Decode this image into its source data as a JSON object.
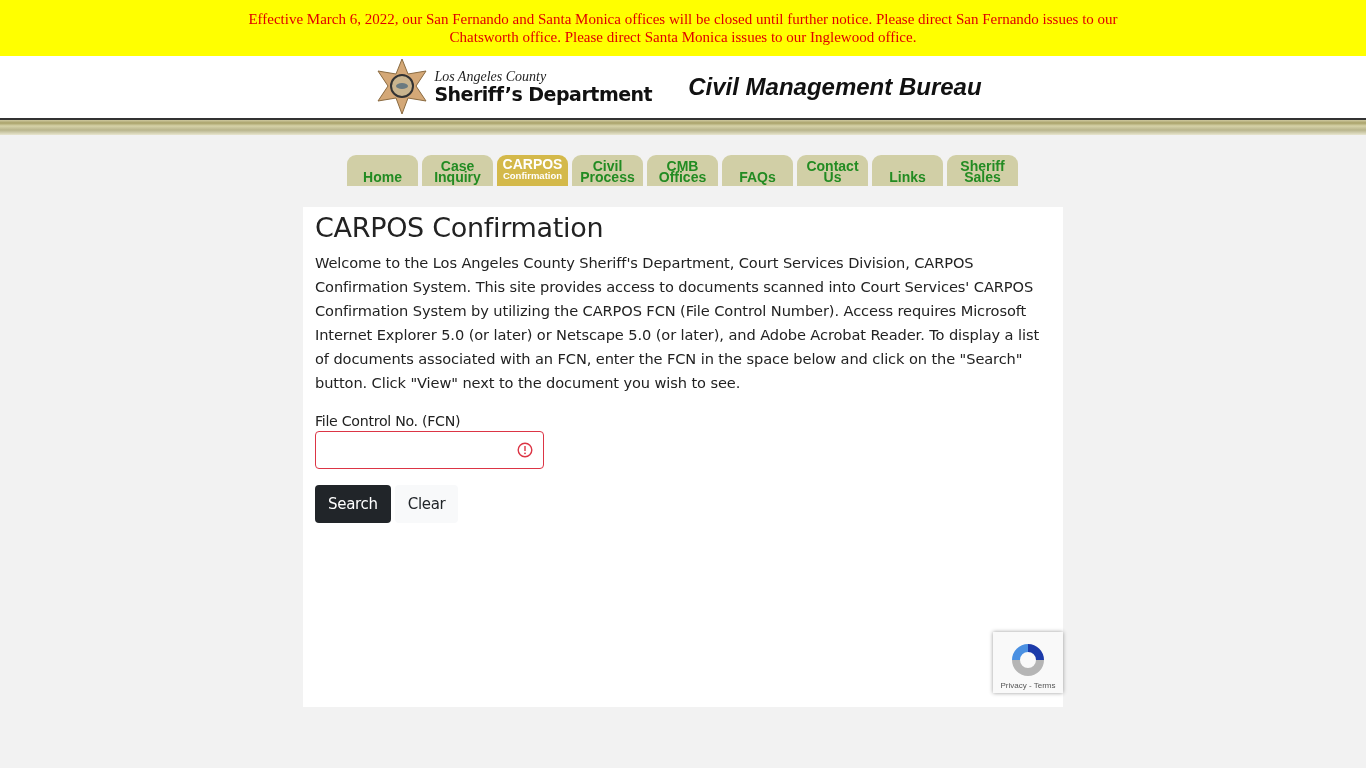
{
  "notice": "Effective March 6, 2022, our San Fernando and Santa Monica offices will be closed until further notice. Please direct San Fernando issues to our Chatsworth office. Please direct Santa Monica issues to our Inglewood office.",
  "header": {
    "county": "Los Angeles County",
    "department": "Sheriff’s Department",
    "bureau": "Civil Management Bureau"
  },
  "tabs": [
    {
      "label": "Home",
      "selected": false
    },
    {
      "label": "Case Inquiry",
      "selected": false
    },
    {
      "label": "CARPOS",
      "sublabel": "Confirmation",
      "selected": true
    },
    {
      "label": "Civil Process",
      "selected": false
    },
    {
      "label": "CMB Offices",
      "selected": false
    },
    {
      "label": "FAQs",
      "selected": false
    },
    {
      "label": "Contact Us",
      "selected": false
    },
    {
      "label": "Links",
      "selected": false
    },
    {
      "label": "Sheriff Sales",
      "selected": false
    }
  ],
  "page": {
    "title": "CARPOS Confirmation",
    "intro": "Welcome to the Los Angeles County Sheriff's Department, Court Services Division, CARPOS Confirmation System. This site provides access to documents scanned into Court Services' CARPOS Confirmation System by utilizing the CARPOS FCN (File Control Number). Access requires Microsoft Internet Explorer 5.0 (or later) or Netscape 5.0 (or later), and Adobe Acrobat Reader. To display a list of documents associated with an FCN, enter the FCN in the space below and click on the \"Search\" button. Click \"View\" next to the document you wish to see.",
    "field": {
      "label": "File Control No. (FCN)",
      "invalid": true
    },
    "buttons": [
      "Search",
      "Clear"
    ]
  },
  "recaptcha": {
    "links": "Privacy - Terms"
  }
}
